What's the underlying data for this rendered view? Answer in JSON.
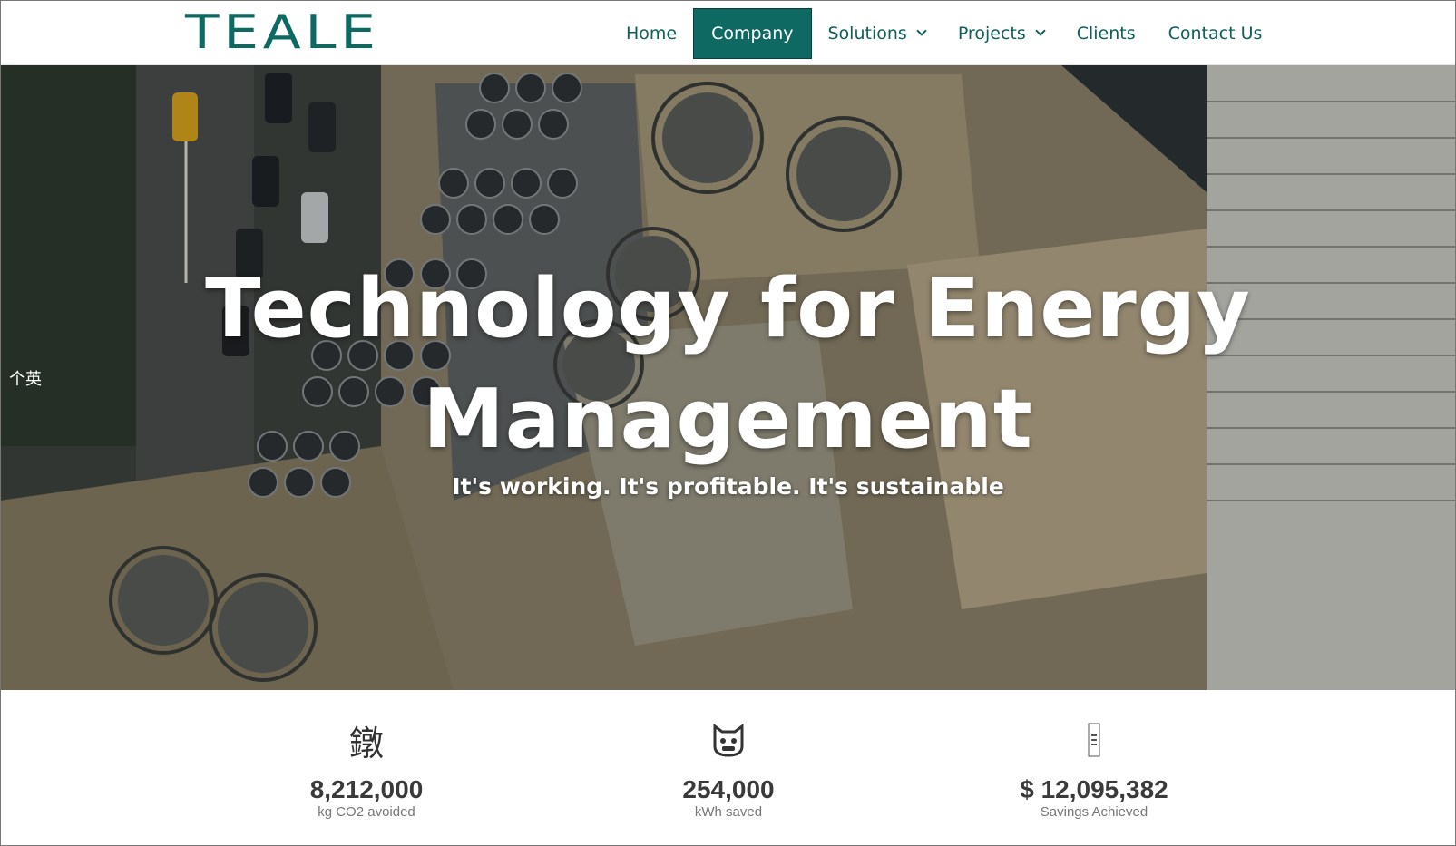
{
  "header": {
    "logo": "TEALE",
    "nav": [
      {
        "label": "Home"
      },
      {
        "label": "Company"
      },
      {
        "label": "Solutions"
      },
      {
        "label": "Projects"
      },
      {
        "label": "Clients"
      },
      {
        "label": "Contact Us"
      }
    ],
    "active_item": "Company"
  },
  "hero": {
    "title_line1": "Technology for Energy",
    "title_line2": "Management",
    "subtitle": "It's working. It's profitable. It's sustainable",
    "side_glyph": "个英"
  },
  "stats": [
    {
      "icon": "leaf-glyph-icon",
      "glyph": "鐓",
      "value": "8,212,000",
      "label": "kg CO2 avoided"
    },
    {
      "icon": "bolt-glyph-icon",
      "glyph": "",
      "value": "254,000",
      "label": "kWh saved"
    },
    {
      "icon": "money-glyph-icon",
      "glyph": "",
      "value": "$ 12,095,382",
      "label": "Savings Achieved"
    }
  ],
  "colors": {
    "brand_teal": "#0e6963",
    "nav_text": "#0e5e5a",
    "stat_value": "#3a3a3a",
    "stat_label": "#777777"
  }
}
